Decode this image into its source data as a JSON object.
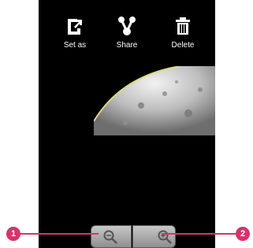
{
  "toolbar": {
    "set_as": {
      "label": "Set as",
      "icon": "set-as-icon"
    },
    "share": {
      "label": "Share",
      "icon": "share-icon"
    },
    "delete": {
      "label": "Delete",
      "icon": "trash-icon"
    }
  },
  "photo": {
    "subject": "moon"
  },
  "zoom_controls": {
    "zoom_out": {
      "icon": "zoom-out-icon"
    },
    "zoom_in": {
      "icon": "zoom-in-icon"
    }
  },
  "callouts": [
    {
      "number": "1",
      "target": "zoom-out-button"
    },
    {
      "number": "2",
      "target": "zoom-in-button"
    }
  ],
  "colors": {
    "callout": "#d6336c",
    "screen_bg": "#000000",
    "page_bg": "#ffffff"
  }
}
